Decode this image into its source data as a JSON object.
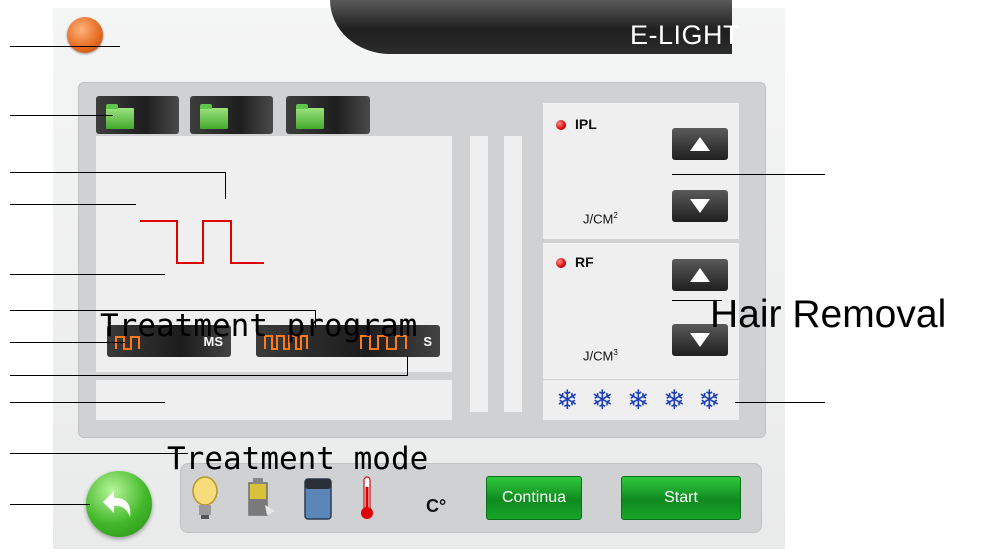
{
  "header": {
    "title": "E-LIGHT"
  },
  "params": [
    {
      "name": "IPL",
      "unit_base": "J/CM",
      "unit_exp": "2",
      "up_icon": "triangle-up-icon",
      "down_icon": "triangle-down-icon"
    },
    {
      "name": "RF",
      "unit_base": "J/CM",
      "unit_exp": "3",
      "up_icon": "triangle-up-icon",
      "down_icon": "triangle-down-icon"
    }
  ],
  "pulse_buttons": [
    {
      "unit": "MS"
    },
    {
      "unit": "S"
    }
  ],
  "cooling_level": 5,
  "bottom": {
    "temperature_unit": "C°",
    "continua_label": "Continua",
    "start_label": "Start"
  },
  "overlay": {
    "treatment_program": "Treatment program",
    "treatment_mode": "Treatment mode",
    "hair_removal": "Hair Removal"
  },
  "colors": {
    "accent_green": "#17a628",
    "waveform_red": "#e00000",
    "snow_blue": "#1c3fb8",
    "led_red": "#d10000"
  }
}
